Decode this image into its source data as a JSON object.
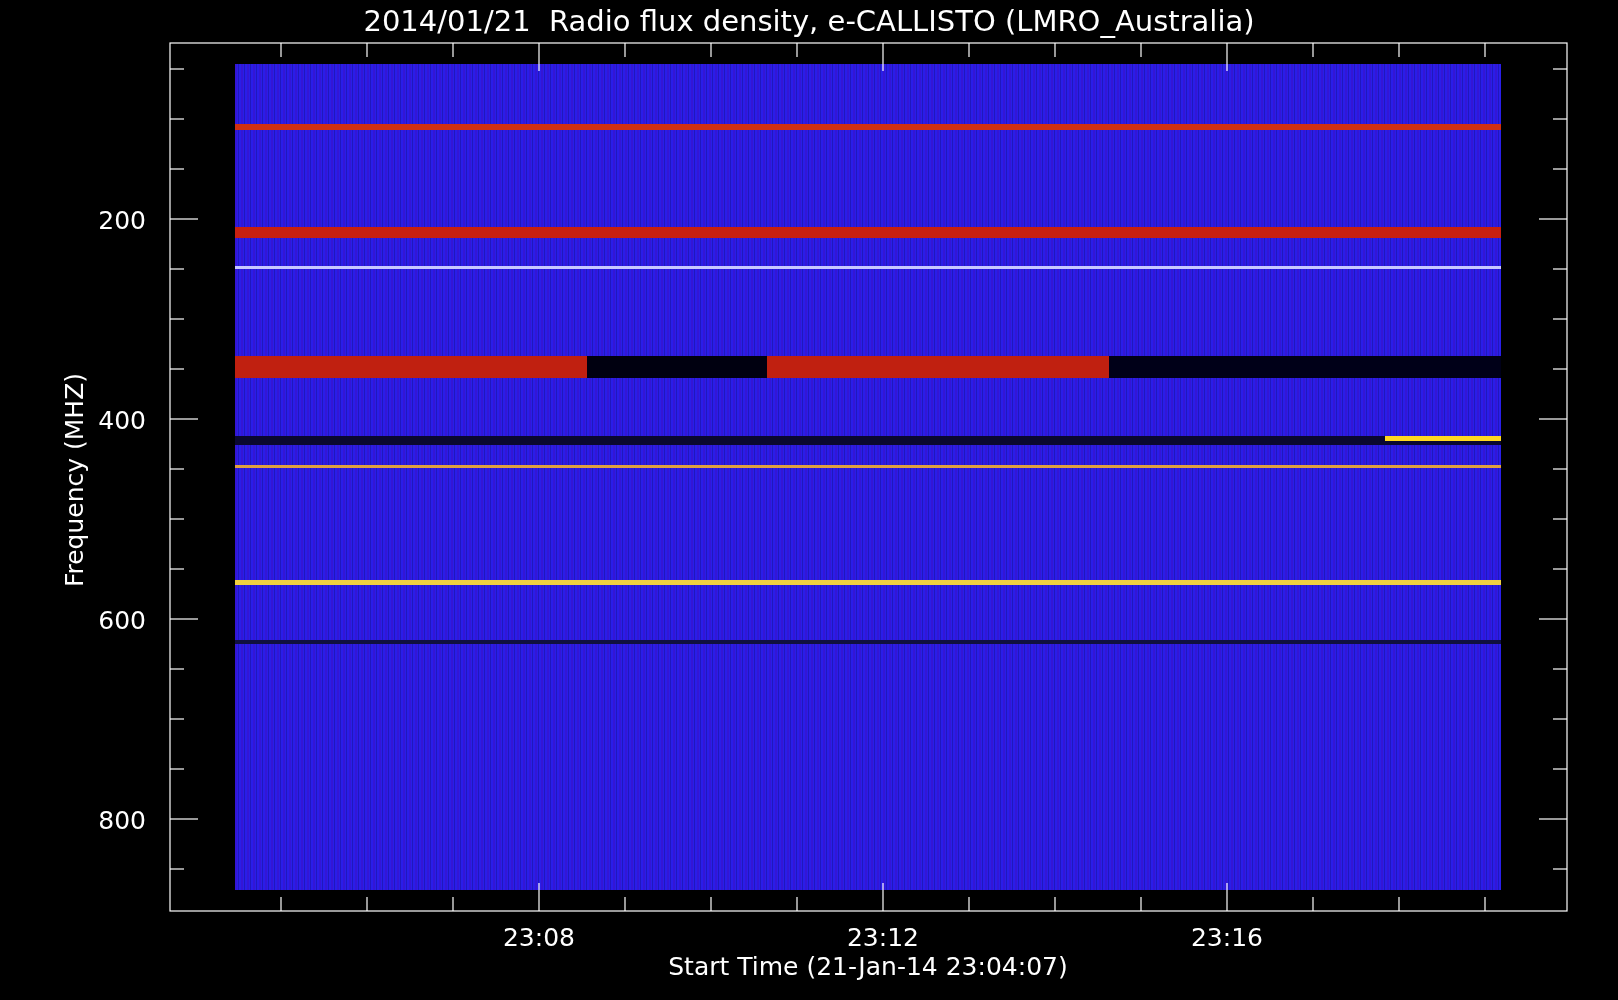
{
  "title": "2014/01/21  Radio flux density, e-CALLISTO (LMRO_Australia)",
  "y_axis": {
    "label": "Frequency (MHZ)",
    "ticks": [
      "200",
      "400",
      "600",
      "800"
    ]
  },
  "x_axis": {
    "label": "Start Time (21-Jan-14 23:04:07)",
    "ticks": [
      "23:08",
      "23:12",
      "23:16"
    ]
  }
}
